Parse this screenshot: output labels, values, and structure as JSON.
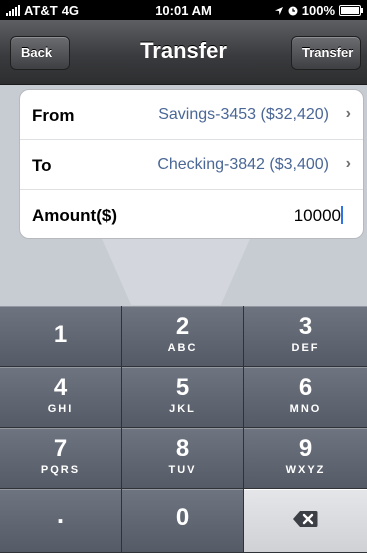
{
  "status_bar": {
    "carrier": "AT&T",
    "network": "4G",
    "time": "10:01 AM",
    "battery": "100%"
  },
  "nav": {
    "title": "Transfer",
    "back_label": "Back",
    "transfer_label": "Transfer"
  },
  "form": {
    "from": {
      "label": "From",
      "value": "Savings-3453 ($32,420)"
    },
    "to": {
      "label": "To",
      "value": "Checking-3842 ($3,400)"
    },
    "amount": {
      "label": "Amount($)",
      "value": "10000"
    }
  },
  "keypad": {
    "keys": [
      {
        "digit": "1",
        "letters": ""
      },
      {
        "digit": "2",
        "letters": "ABC"
      },
      {
        "digit": "3",
        "letters": "DEF"
      },
      {
        "digit": "4",
        "letters": "GHI"
      },
      {
        "digit": "5",
        "letters": "JKL"
      },
      {
        "digit": "6",
        "letters": "MNO"
      },
      {
        "digit": "7",
        "letters": "PQRS"
      },
      {
        "digit": "8",
        "letters": "TUV"
      },
      {
        "digit": "9",
        "letters": "WXYZ"
      }
    ],
    "bottom": {
      "decimal": ".",
      "zero": "0"
    },
    "delete_icon": "backspace-icon"
  },
  "colors": {
    "link_value": "#4a6796",
    "cursor": "#2f73e6",
    "nav_bar": "#3a3b3e",
    "key": "#626873"
  }
}
